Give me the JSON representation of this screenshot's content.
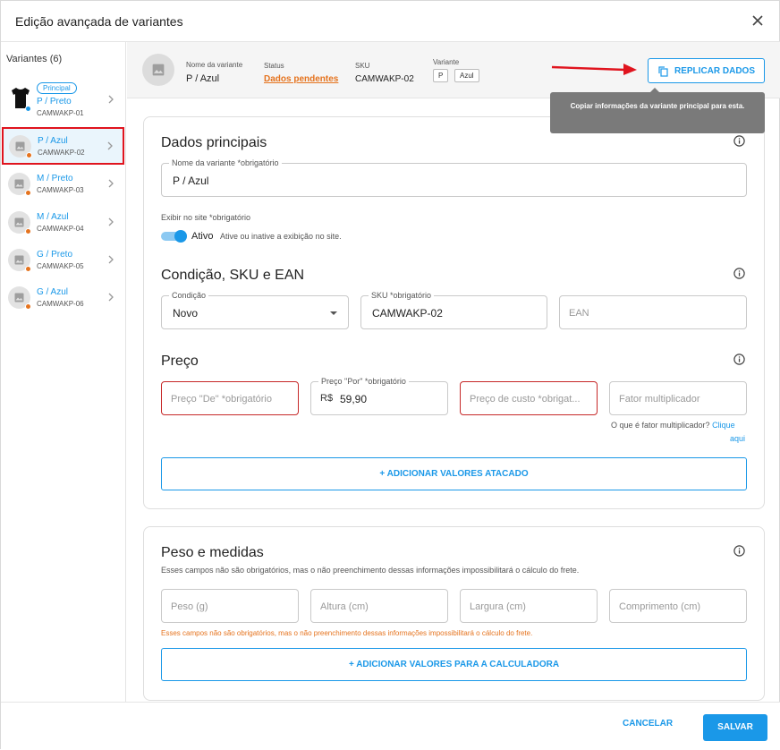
{
  "modal": {
    "title": "Edição avançada de variantes"
  },
  "sidebar": {
    "title": "Variantes (6)",
    "items": [
      {
        "badge": "Principal",
        "name": "P / Preto",
        "sku": "CAMWAKP-01"
      },
      {
        "name": "P / Azul",
        "sku": "CAMWAKP-02"
      },
      {
        "name": "M / Preto",
        "sku": "CAMWAKP-03"
      },
      {
        "name": "M / Azul",
        "sku": "CAMWAKP-04"
      },
      {
        "name": "G / Preto",
        "sku": "CAMWAKP-05"
      },
      {
        "name": "G / Azul",
        "sku": "CAMWAKP-06"
      }
    ]
  },
  "topbar": {
    "name_label": "Nome da variante",
    "name_value": "P / Azul",
    "status_label": "Status",
    "status_value": "Dados pendentes",
    "sku_label": "SKU",
    "sku_value": "CAMWAKP-02",
    "variant_label": "Variante",
    "variant_chips": [
      "P",
      "Azul"
    ],
    "replicate_label": "REPLICAR DADOS",
    "tooltip": "Copiar informações da variante principal para esta."
  },
  "dados": {
    "title": "Dados principais",
    "name_label": "Nome da variante *obrigatório",
    "name_value": "P / Azul",
    "show_label": "Exibir no site *obrigatório",
    "toggle_state": "Ativo",
    "toggle_hint": "Ative ou inative a exibição no site."
  },
  "condicao": {
    "title": "Condição, SKU e EAN",
    "cond_label": "Condição",
    "cond_value": "Novo",
    "sku_label": "SKU *obrigatório",
    "sku_value": "CAMWAKP-02",
    "ean_placeholder": "EAN"
  },
  "preco": {
    "title": "Preço",
    "de_placeholder": "Preço \"De\" *obrigatório",
    "por_label": "Preço \"Por\" *obrigatório",
    "por_prefix": "R$",
    "por_value": "59,90",
    "custo_placeholder": "Preço de custo *obrigat...",
    "fator_placeholder": "Fator multiplicador",
    "fator_help": "O que é fator multiplicador?",
    "fator_link_1": "Clique",
    "fator_link_2": "aqui",
    "atacado_button": "+ ADICIONAR VALORES ATACADO"
  },
  "peso": {
    "title": "Peso e medidas",
    "subtitle": "Esses campos não são obrigatórios, mas o não preenchimento dessas informações impossibilitará o cálculo do frete.",
    "peso_placeholder": "Peso (g)",
    "altura_placeholder": "Altura (cm)",
    "largura_placeholder": "Largura (cm)",
    "comprimento_placeholder": "Comprimento (cm)",
    "warning": "Esses campos não são obrigatórios, mas o não preenchimento dessas informações impossibilitará o cálculo do frete.",
    "calc_button": "+ ADICIONAR VALORES PARA A CALCULADORA"
  },
  "footer": {
    "cancel_label": "CANCELAR",
    "save_label": "SALVAR"
  },
  "colors": {
    "accent": "#1a98e8",
    "pending": "#e5731e",
    "error": "#c62828",
    "highlight": "#e0141e"
  }
}
